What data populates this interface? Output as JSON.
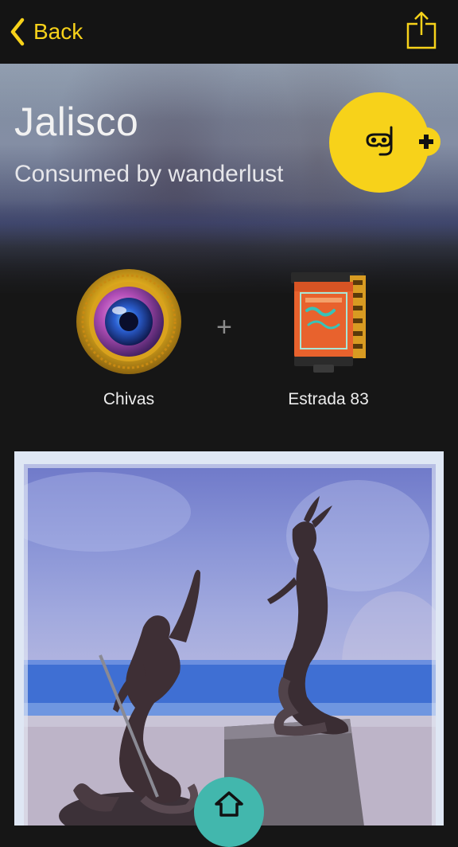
{
  "nav": {
    "back_label": "Back",
    "back_icon": "chevron-left-icon",
    "share_icon": "share-icon",
    "accent": "#f7d21a"
  },
  "hero": {
    "title": "Jalisco",
    "subtitle": "Consumed by wanderlust",
    "fab_icon": "snorkel-mask-icon",
    "fab_plus_icon": "plus-icon"
  },
  "combo": {
    "lens_label": "Chivas",
    "film_label": "Estrada 83",
    "separator": "+"
  },
  "photo": {
    "description_icon": "photo"
  },
  "footer": {
    "home_icon": "home-icon",
    "home_color": "#42b7ad"
  }
}
